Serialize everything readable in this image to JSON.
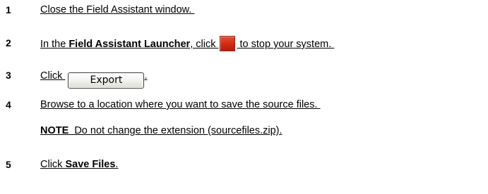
{
  "steps": [
    {
      "number": "1",
      "text": "Close the Field Assistant window. "
    },
    {
      "number": "2",
      "pre": "In the ",
      "bold": "Field Assistant Launcher",
      "mid": ", click ",
      "icon": "stop-icon",
      "icon_color": "#d42f18",
      "post": " to stop your system. "
    },
    {
      "number": "3",
      "pre": "Click ",
      "button_label": "Export",
      "post": "."
    },
    {
      "number": "4",
      "text": "Browse to a location where you want to save the source files. "
    },
    {
      "number": "",
      "note_label": "NOTE",
      "note_text": "  Do not change the extension (sourcefiles.zip)."
    },
    {
      "number": "5",
      "pre": "Click ",
      "bold": "Save Files",
      "post": "."
    }
  ]
}
